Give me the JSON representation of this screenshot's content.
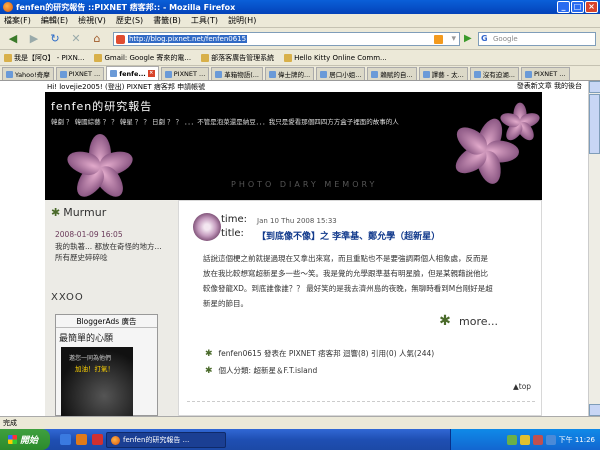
{
  "window": {
    "title": "fenfen的研究報告 ::PIXNET 痞客邦:: - Mozilla Firefox"
  },
  "menu": [
    "檔案(F)",
    "編輯(E)",
    "檢視(V)",
    "歷史(S)",
    "書籤(B)",
    "工具(T)",
    "說明(H)"
  ],
  "nav": {
    "url": "http://blog.pixnet.net/fenfen0615",
    "search_placeholder": "Google"
  },
  "bookmarks": [
    "我是【阿Q】 - PIXN...",
    "Gmail: Google 寄來的電...",
    "部落客廣告管理系統",
    "Hello Kitty Online Comm..."
  ],
  "tabs": [
    "Yahoo!奇摩",
    "PIXNET ...",
    "fenfe...",
    "PIXNET ...",
    "革箱物語(...",
    "偉士牌的...",
    "居口小姐...",
    "賴賦的自...",
    "譯藝 - 太...",
    "沒有迫湖...",
    "PIXNET ..."
  ],
  "active_tab_index": 2,
  "page": {
    "topline": "Hi! lovejie2005! (登出)  PIXNET 痞客邦  申請帳號",
    "topline_right": "發表新文章    我的後台",
    "blog_title": "fenfen的研究報告",
    "blog_subtitle": "韓劇 ？ 韓國綜藝 ？ ？ 韓星 ？ ？ 日劇 ？ ？ ．．．不管是泡菜還是納豆．．．我只是愛看那個四四方方盒子裡面的故事的人",
    "banner_stamp": "PHOTO DIARY  MEMORY",
    "sidebar": {
      "murmur_title": "Murmur",
      "murmur_date": "2008-01-09 16:05",
      "murmur_text": "我的執著... 都放在奇怪的地方...",
      "murmur_all": "所有歷史碎碎唸",
      "section_title": "XXOO",
      "ad_header": "BloggerAds 廣告",
      "ad_title": "最簡單的心願",
      "ad_line1": "邀您一同為他們",
      "ad_line2": "加油！打氣！"
    },
    "post": {
      "time_label": "time:",
      "title_label": "title:",
      "date": "Jan 10 Thu 2008 15:33",
      "title": "【到底像不像】之 李準基、鄭允學（超新星）",
      "body": [
        "話說這個梗之前就提過現在又拿出來寫，而且重點也不是要強調兩個人相象處，反而是",
        "放在我比較想寫超新星多一些～笑。我是覺的允學跟準基有明星臉，但是某親藉說他比",
        "較像發龍XD。到底誰像誰？？ 最好笑的是我去濟州島的夜晚，無聊時看到M台剛好是超",
        "新星的節目。"
      ],
      "more_label": "more...",
      "meta1": "fenfen0615 發表在 PIXNET 痞客邦 迴響(8) 引用(0) 人氣(244)",
      "meta2": "個人分類: 超新星＆F.T.island",
      "top_label": "▲top"
    }
  },
  "status": "完成",
  "taskbar": {
    "start": "開始",
    "task": "fenfen的研究報告 ...",
    "clock": "下午 11:26"
  }
}
